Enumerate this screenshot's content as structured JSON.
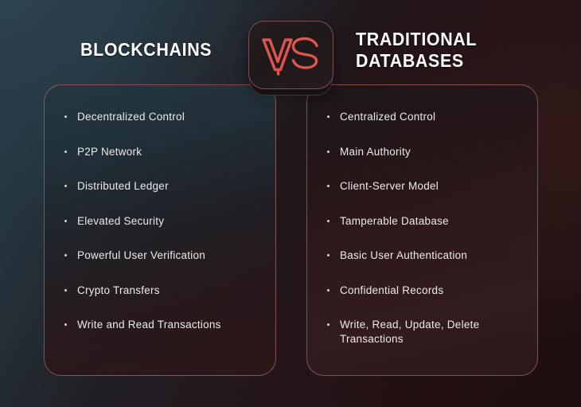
{
  "background": {
    "gradient_from": "#2a3e4a",
    "gradient_to": "#1b0d0d"
  },
  "badge": {
    "label": "VS",
    "accent_color": "#e0544f",
    "border_color": "#c47a78",
    "icon": "vs-versus-icon"
  },
  "columns": [
    {
      "id": "blockchains",
      "title": "Blockchains",
      "items": [
        "Decentralized Control",
        "P2P Network",
        "Distributed Ledger",
        "Elevated Security",
        "Powerful User Verification",
        "Crypto Transfers",
        "Write and Read Transactions"
      ]
    },
    {
      "id": "traditional-databases",
      "title": "Traditional\nDatabases",
      "items": [
        "Centralized Control",
        "Main Authority",
        "Client-Server Model",
        "Tamperable Database",
        "Basic User Authentication",
        "Confidential Records",
        "Write, Read, Update, Delete Transactions"
      ]
    }
  ]
}
